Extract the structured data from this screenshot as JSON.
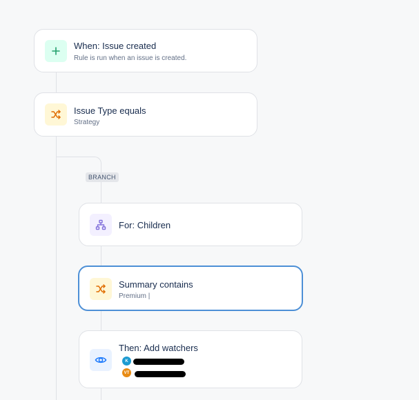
{
  "colors": {
    "background": "#f7f8f9",
    "card_border": "#dfe1e6",
    "selected_border": "#4c8fd6",
    "trigger_icon": "#22a06b",
    "condition_icon": "#e06c00",
    "branch_icon": "#8270db",
    "action_icon": "#1d7afc"
  },
  "steps": {
    "trigger": {
      "icon": "plus-icon",
      "title": "When: Issue created",
      "subtitle": "Rule is run when an issue is created."
    },
    "condition_issue_type": {
      "icon": "shuffle-icon",
      "title": "Issue Type equals",
      "subtitle": "Strategy"
    },
    "branch": {
      "tag": "BRANCH",
      "icon": "hierarchy-icon",
      "title": "For: Children"
    },
    "condition_summary": {
      "icon": "shuffle-icon",
      "title": "Summary contains",
      "subtitle": "Premium |"
    },
    "action": {
      "icon": "eye-icon",
      "title": "Then: Add watchers",
      "watchers": [
        {
          "initials": "K",
          "color": "#1d9bd1"
        },
        {
          "initials": "VT",
          "color": "#e88b14"
        }
      ]
    }
  }
}
